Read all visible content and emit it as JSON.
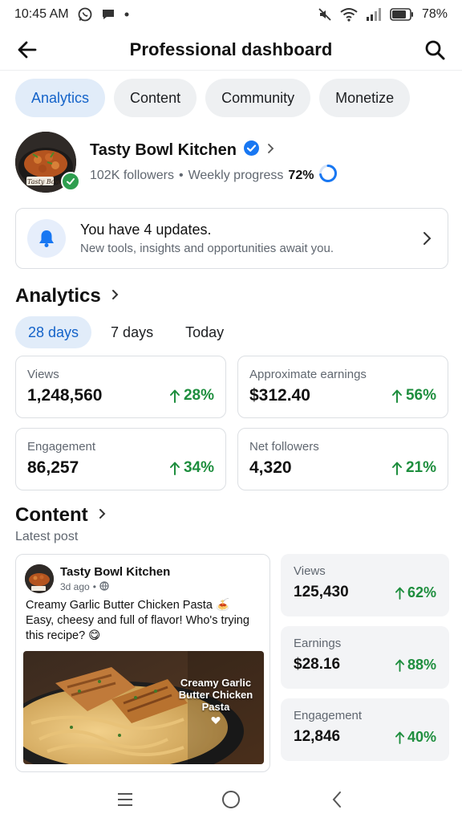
{
  "status_bar": {
    "time": "10:45 AM",
    "battery": "78%",
    "icons": [
      "whatsapp-icon",
      "message-icon",
      "dot-icon",
      "mute-icon",
      "wifi-icon",
      "signal-icon",
      "battery-icon"
    ]
  },
  "header": {
    "title": "Professional dashboard",
    "back_icon": "back-arrow-icon",
    "search_icon": "search-icon"
  },
  "tabs": [
    {
      "label": "Analytics",
      "active": true
    },
    {
      "label": "Content",
      "active": false
    },
    {
      "label": "Community",
      "active": false
    },
    {
      "label": "Monetize",
      "active": false
    }
  ],
  "profile": {
    "name": "Tasty Bowl Kitchen",
    "avatar_text": "Tasty Bowl",
    "followers": "102K followers",
    "separator": "•",
    "progress_label": "Weekly progress",
    "progress_value": "72%",
    "progress_fraction": 0.72,
    "verified": true
  },
  "updates": {
    "title": "You have 4 updates.",
    "subtitle": "New tools, insights and opportunities await you."
  },
  "analytics": {
    "title": "Analytics",
    "ranges": [
      {
        "label": "28 days",
        "active": true
      },
      {
        "label": "7 days",
        "active": false
      },
      {
        "label": "Today",
        "active": false
      }
    ],
    "metrics": [
      {
        "label": "Views",
        "value": "1,248,560",
        "change": "28%"
      },
      {
        "label": "Approximate earnings",
        "value": "$312.40",
        "change": "56%"
      },
      {
        "label": "Engagement",
        "value": "86,257",
        "change": "34%"
      },
      {
        "label": "Net followers",
        "value": "4,320",
        "change": "21%"
      }
    ]
  },
  "content": {
    "title": "Content",
    "subtitle": "Latest post",
    "post": {
      "author": "Tasty Bowl Kitchen",
      "time": "3d ago",
      "separator": "•",
      "line1": "Creamy Garlic Butter Chicken Pasta 🍝",
      "line2": "Easy, cheesy and full of flavor! Who's trying this recipe? 😋",
      "image_caption": "Creamy Garlic Butter Chicken Pasta"
    },
    "stats": [
      {
        "label": "Views",
        "value": "125,430",
        "change": "62%"
      },
      {
        "label": "Earnings",
        "value": "$28.16",
        "change": "88%"
      },
      {
        "label": "Engagement",
        "value": "12,846",
        "change": "40%"
      }
    ]
  },
  "navbar": {
    "items": [
      "menu-icon",
      "home-circle-icon",
      "back-chevron-icon"
    ]
  },
  "colors": {
    "accent": "#1463c9",
    "accent_bg": "#e1ecf9",
    "positive": "#1e8e3e",
    "verified_blue": "#1877f2"
  }
}
